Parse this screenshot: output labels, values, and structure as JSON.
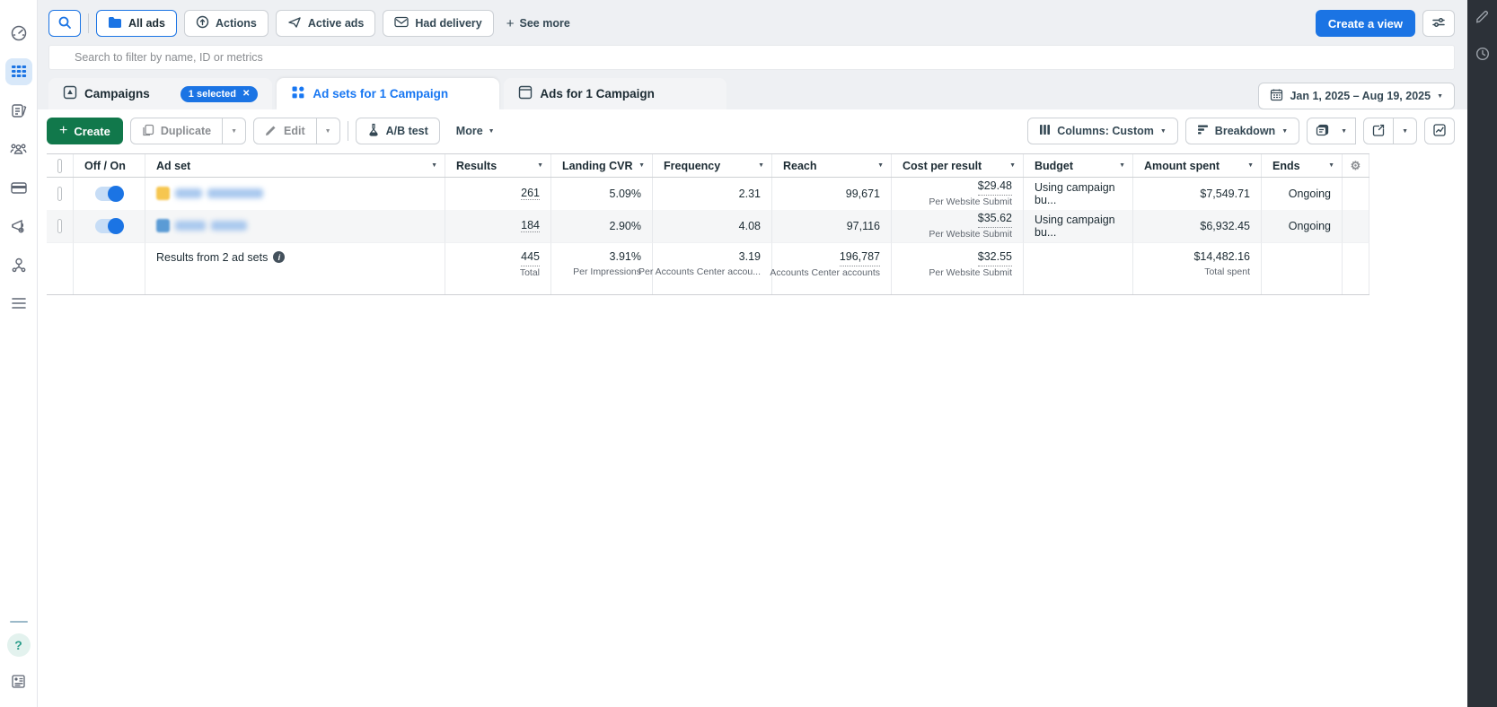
{
  "colors": {
    "accent": "#1b74e4",
    "create_green": "#11784b",
    "active_tab_text": "#1877f2",
    "rail_bg": "#2c3138",
    "badge_bg": "#1b74e4",
    "toggle_on": "#1b74e4"
  },
  "icons": {
    "caret": "▼",
    "gear": "⚙",
    "close": "✕",
    "plus": "+",
    "info": "i",
    "help": "?"
  },
  "sidebar": {
    "items": [
      {
        "name": "account-overview"
      },
      {
        "name": "campaigns",
        "active": true
      },
      {
        "name": "pages"
      },
      {
        "name": "audiences"
      },
      {
        "name": "billing"
      },
      {
        "name": "ads-settings"
      },
      {
        "name": "business-assets"
      },
      {
        "name": "all-tools"
      }
    ],
    "help_label": "?"
  },
  "topbar": {
    "filters": [
      {
        "label": "All ads",
        "selected": true
      },
      {
        "label": "Actions"
      },
      {
        "label": "Active ads"
      },
      {
        "label": "Had delivery"
      }
    ],
    "see_more": "See more",
    "create_view": "Create a view"
  },
  "search": {
    "placeholder": "Search to filter by name, ID or metrics"
  },
  "tabs": [
    {
      "label": "Campaigns",
      "badge": "1 selected"
    },
    {
      "label": "Ad sets for 1 Campaign",
      "active": true
    },
    {
      "label": "Ads for 1 Campaign"
    }
  ],
  "date_range": {
    "label": "Jan 1, 2025 – Aug 19, 2025"
  },
  "toolbar": {
    "create": "Create",
    "duplicate": "Duplicate",
    "edit": "Edit",
    "ab_test": "A/B test",
    "more": "More",
    "columns": "Columns: Custom",
    "breakdown": "Breakdown"
  },
  "table": {
    "columns": [
      {
        "label": "Off / On"
      },
      {
        "label": "Ad set"
      },
      {
        "label": "Results"
      },
      {
        "label": "Landing CVR"
      },
      {
        "label": "Frequency"
      },
      {
        "label": "Reach"
      },
      {
        "label": "Cost per result"
      },
      {
        "label": "Budget"
      },
      {
        "label": "Amount spent"
      },
      {
        "label": "Ends"
      }
    ],
    "rows": [
      {
        "toggle_on": true,
        "name_redacted": true,
        "results": "261",
        "landing_cvr": "5.09%",
        "frequency": "2.31",
        "reach": "99,671",
        "cost": "$29.48",
        "cost_sub": "Per Website Submit",
        "budget": "Using campaign bu...",
        "amount_spent": "$7,549.71",
        "ends": "Ongoing"
      },
      {
        "toggle_on": true,
        "name_redacted": true,
        "results": "184",
        "landing_cvr": "2.90%",
        "frequency": "4.08",
        "reach": "97,116",
        "cost": "$35.62",
        "cost_sub": "Per Website Submit",
        "budget": "Using campaign bu...",
        "amount_spent": "$6,932.45",
        "ends": "Ongoing"
      }
    ],
    "summary": {
      "label": "Results from 2 ad sets",
      "results": "445",
      "results_sub": "Total",
      "cvr": "3.91%",
      "cvr_sub": "Per Impressions",
      "freq": "3.19",
      "freq_sub": "Per Accounts Center accou...",
      "reach": "196,787",
      "reach_sub": "Accounts Center accounts",
      "cost": "$32.55",
      "cost_sub": "Per Website Submit",
      "spent": "$14,482.16",
      "spent_sub": "Total spent"
    }
  }
}
